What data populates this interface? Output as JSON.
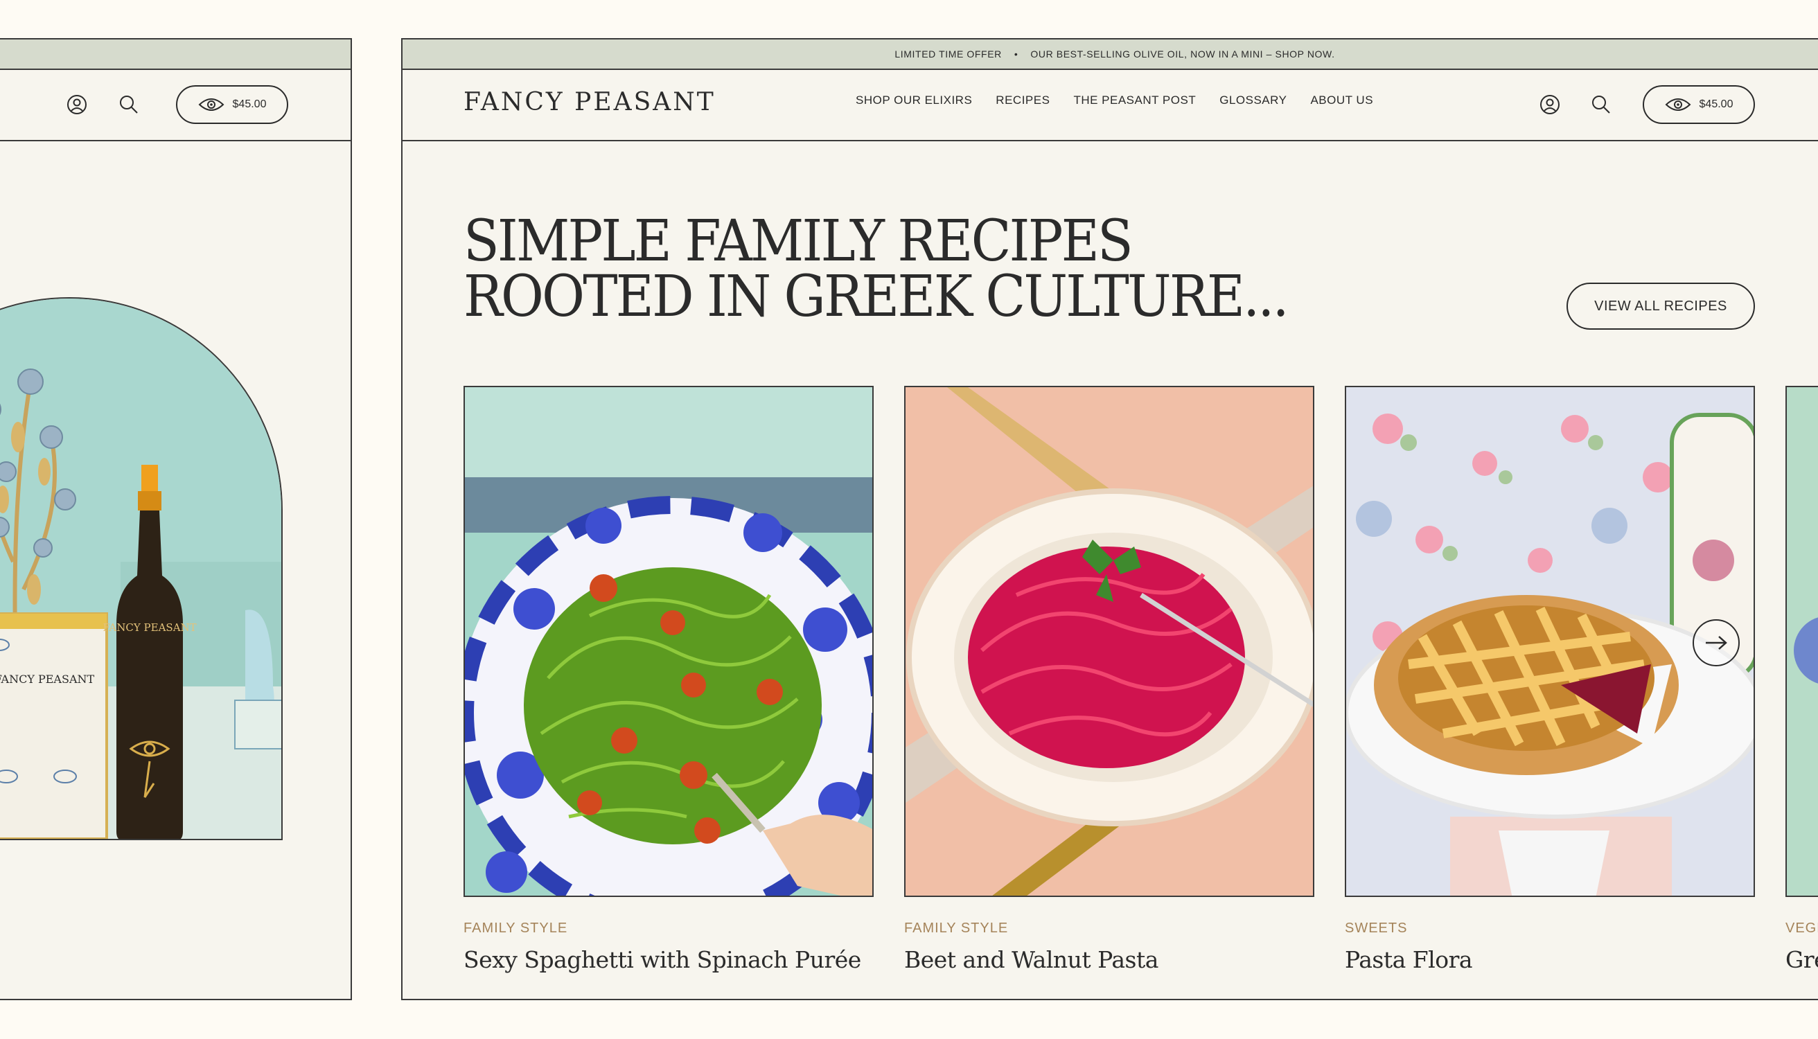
{
  "colors": {
    "background": "#fefbf4",
    "panel": "#f7f5ee",
    "announcement_bar": "#d6dbcd",
    "category_text": "#a5845a",
    "ink": "#2b2b2b"
  },
  "announcement": {
    "offer": "LIMITED TIME OFFER",
    "separator": "•",
    "message": "OUR BEST-SELLING OLIVE OIL, NOW IN A MINI – SHOP NOW."
  },
  "header": {
    "logo": "FANCY PEASANT",
    "nav": [
      {
        "label": "SHOP OUR ELIXIRS"
      },
      {
        "label": "RECIPES"
      },
      {
        "label": "THE PEASANT POST"
      },
      {
        "label": "GLOSSARY"
      },
      {
        "label": "ABOUT US"
      }
    ],
    "account_icon": "user-circle-icon",
    "search_icon": "search-icon",
    "cart_icon": "eye-icon",
    "cart_total": "$45.00"
  },
  "hero": {
    "headline_line1": "SIMPLE FAMILY RECIPES",
    "headline_line2": "ROOTED IN GREEK CULTURE...",
    "view_all_label": "VIEW ALL RECIPES"
  },
  "recipes": [
    {
      "category": "FAMILY STYLE",
      "title": "Sexy Spaghetti with Spinach Purée"
    },
    {
      "category": "FAMILY STYLE",
      "title": "Beet and Walnut Pasta"
    },
    {
      "category": "SWEETS",
      "title": "Pasta Flora"
    },
    {
      "category": "VEGE",
      "title": "Gre"
    }
  ],
  "carousel": {
    "next_icon": "arrow-right-icon"
  },
  "left_preview": {
    "cart_total": "$45.00",
    "bottle_label": "FANCY PEASANT",
    "tin_label": "FANCY PEASANT"
  }
}
